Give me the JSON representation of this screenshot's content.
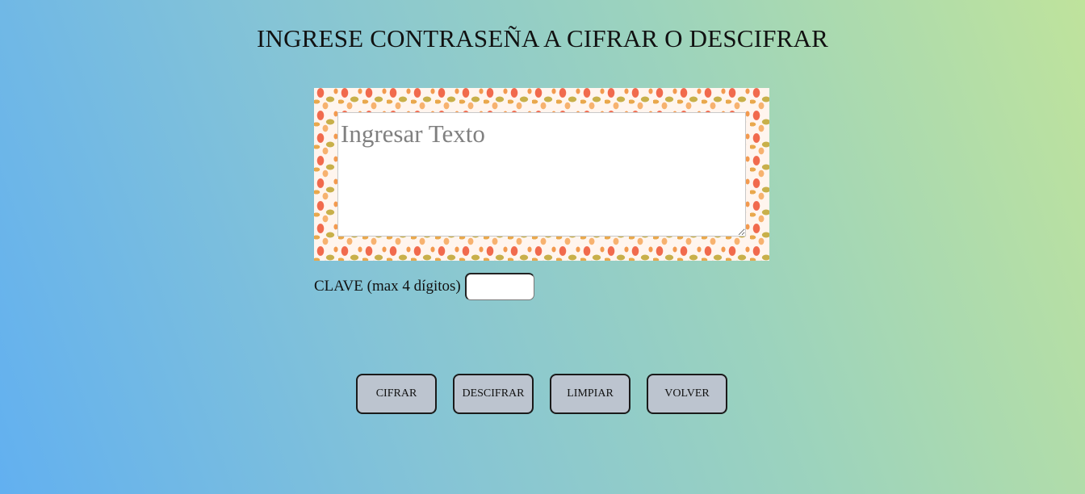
{
  "header": {
    "title": "INGRESE CONTRASEÑA A CIFRAR O DESCIFRAR"
  },
  "text_input": {
    "placeholder": "Ingresar Texto",
    "value": ""
  },
  "clave": {
    "label": "CLAVE (max 4 dígitos)",
    "value": ""
  },
  "buttons": {
    "cifrar": "CIFRAR",
    "descifrar": "DESCIFRAR",
    "limpiar": "LIMPIAR",
    "volver": "VOLVER"
  },
  "colors": {
    "background_left": "#62b0f0",
    "background_right": "#bfe39c",
    "button_fill": "#bcc4cf"
  }
}
